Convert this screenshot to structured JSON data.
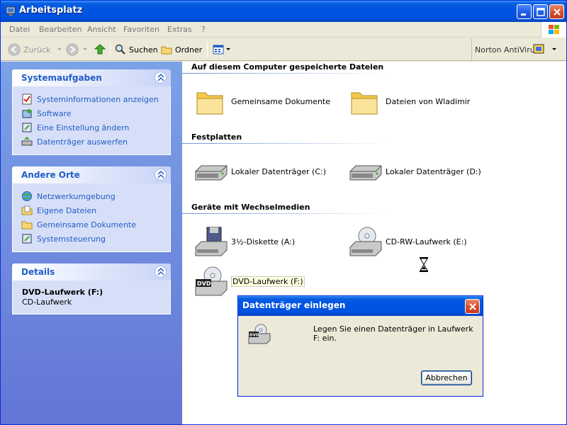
{
  "window": {
    "title": "Arbeitsplatz"
  },
  "menu": [
    "Datei",
    "Bearbeiten",
    "Ansicht",
    "Favoriten",
    "Extras",
    "?"
  ],
  "toolbar": {
    "back": "Zurück",
    "search": "Suchen",
    "folders": "Ordner",
    "norton": "Norton AntiVirus"
  },
  "taskpane": {
    "system": {
      "title": "Systemaufgaben",
      "items": [
        "Systeminformationen anzeigen",
        "Software",
        "Eine Einstellung ändern",
        "Datenträger auswerfen"
      ]
    },
    "other": {
      "title": "Andere Orte",
      "items": [
        "Netzwerkumgebung",
        "Eigene Dateien",
        "Gemeinsame Dokumente",
        "Systemsteuerung"
      ]
    },
    "details": {
      "title": "Details",
      "name": "DVD-Laufwerk (F:)",
      "type": "CD-Laufwerk"
    }
  },
  "groups": {
    "stored": {
      "title": "Auf diesem Computer gespeicherte Dateien",
      "items": [
        "Gemeinsame Dokumente",
        "Dateien von Wladimir"
      ]
    },
    "disks": {
      "title": "Festplatten",
      "items": [
        "Lokaler Datenträger (C:)",
        "Lokaler Datenträger (D:)"
      ]
    },
    "removable": {
      "title": "Geräte mit Wechselmedien",
      "items": [
        "3½-Diskette (A:)",
        "CD-RW-Laufwerk (E:)",
        "DVD-Laufwerk (F:)"
      ]
    }
  },
  "dialog": {
    "title": "Datenträger einlegen",
    "message": "Legen Sie einen Datenträger in Laufwerk F: ein.",
    "button": "Abbrechen"
  }
}
